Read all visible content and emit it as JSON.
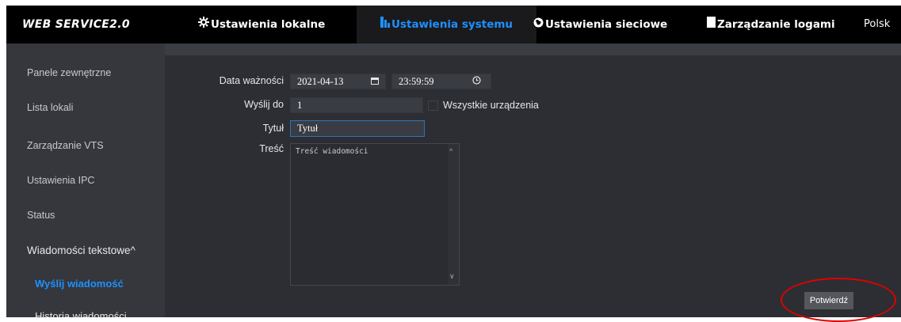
{
  "header": {
    "brand": "WEB SERVICE2.0",
    "nav": [
      {
        "label": "Ustawienia lokalne",
        "icon": "gear-icon",
        "active": false
      },
      {
        "label": "Ustawienia systemu",
        "icon": "system-settings-icon",
        "active": true
      },
      {
        "label": "Ustawienia sieciowe",
        "icon": "globe-icon",
        "active": false
      },
      {
        "label": "Zarządzanie logami",
        "icon": "log-icon",
        "active": false
      }
    ],
    "language": "Polsk"
  },
  "sidebar": {
    "items": [
      {
        "label": "Panele zewnętrzne"
      },
      {
        "label": "Lista lokali"
      },
      {
        "label": "Zarządzanie VTS"
      },
      {
        "label": "Ustawienia IPC"
      },
      {
        "label": "Status"
      }
    ],
    "group": {
      "label": "Wiadomości tekstowe",
      "expanded_icon": "^"
    },
    "subitems": [
      {
        "label": "Wyślij wiadomość",
        "active": true
      },
      {
        "label": "Historia wiadomości",
        "active": false
      }
    ]
  },
  "form": {
    "expiry_label": "Data ważności",
    "expiry_date": "2021-04-13",
    "expiry_time": "23:59:59",
    "send_to_label": "Wyślij do",
    "send_to_value": "1",
    "all_devices_label": "Wszystkie urządzenia",
    "all_devices_checked": false,
    "title_label": "Tytuł",
    "title_value": "Tytuł",
    "content_label": "Treść",
    "content_placeholder": "Treść wiadomości",
    "confirm_label": "Potwierdź"
  },
  "colors": {
    "accent": "#1e90ff",
    "annotation": "#e00000",
    "panel": "#2c2e34",
    "topbar": "#000000"
  }
}
